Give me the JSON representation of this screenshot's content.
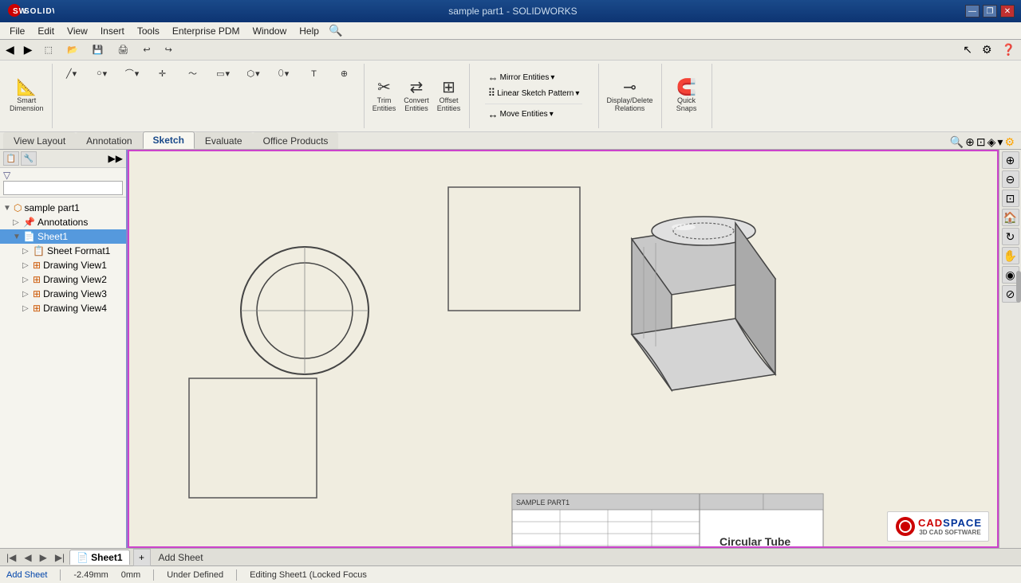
{
  "app": {
    "name": "SOLIDWORKS",
    "title": "sample part1 - SOLIDWORKS",
    "logo": "SW"
  },
  "window_controls": {
    "minimize": "—",
    "maximize": "□",
    "close": "✕",
    "restore": "❐"
  },
  "menu": {
    "items": [
      "File",
      "Edit",
      "View",
      "Insert",
      "Tools",
      "Enterprise PDM",
      "Window",
      "Help"
    ]
  },
  "toolbar": {
    "top_icons": [
      "⬚",
      "💾",
      "↩",
      "↪",
      "▶",
      "⚙"
    ],
    "smart_dimension": "Smart\nDimension",
    "trim_entities": "Trim\nEntities",
    "convert_entities": "Convert\nEntities",
    "offset_entities": "Offset\nEntities",
    "mirror_entities": "Mirror Entities",
    "linear_sketch": "Linear Sketch Pattern",
    "move_entities": "Move Entities",
    "display_delete": "Display/Delete\nRelations",
    "quick_snaps": "Quick\nSnaps"
  },
  "ribbon_tabs": [
    "View Layout",
    "Annotation",
    "Sketch",
    "Evaluate",
    "Office Products"
  ],
  "active_tab": "Sketch",
  "tree": {
    "root": "sample part1",
    "items": [
      {
        "label": "Annotations",
        "level": 1,
        "expanded": false,
        "icon": "anno"
      },
      {
        "label": "Sheet1",
        "level": 1,
        "expanded": true,
        "icon": "sheet",
        "selected": true
      },
      {
        "label": "Sheet Format1",
        "level": 2,
        "expanded": false,
        "icon": "format"
      },
      {
        "label": "Drawing View1",
        "level": 2,
        "expanded": false,
        "icon": "view"
      },
      {
        "label": "Drawing View2",
        "level": 2,
        "expanded": false,
        "icon": "view"
      },
      {
        "label": "Drawing View3",
        "level": 2,
        "expanded": false,
        "icon": "view"
      },
      {
        "label": "Drawing View4",
        "level": 2,
        "expanded": false,
        "icon": "view"
      }
    ]
  },
  "drawing": {
    "views": [
      "circle",
      "rectangle-top-right",
      "cylinder-3d",
      "rectangle-bottom-left"
    ],
    "title_block": {
      "part_name": "Circular Tube",
      "cells": [
        "",
        "",
        "",
        "",
        "",
        "",
        "",
        ""
      ]
    }
  },
  "bottom": {
    "nav_prev": "◀",
    "nav_next": "▶",
    "sheet1_label": "Sheet1",
    "add_sheet": "Add Sheet"
  },
  "statusbar": {
    "x": "-2.49mm",
    "y": "0mm",
    "status": "Under Defined",
    "editing": "Editing Sheet1 (Locked Focus"
  },
  "watermark": {
    "brand": "CADSPACE",
    "sub": "3D CAD SOFTWARE",
    "cad": "CAD",
    "space": "SPACE"
  }
}
